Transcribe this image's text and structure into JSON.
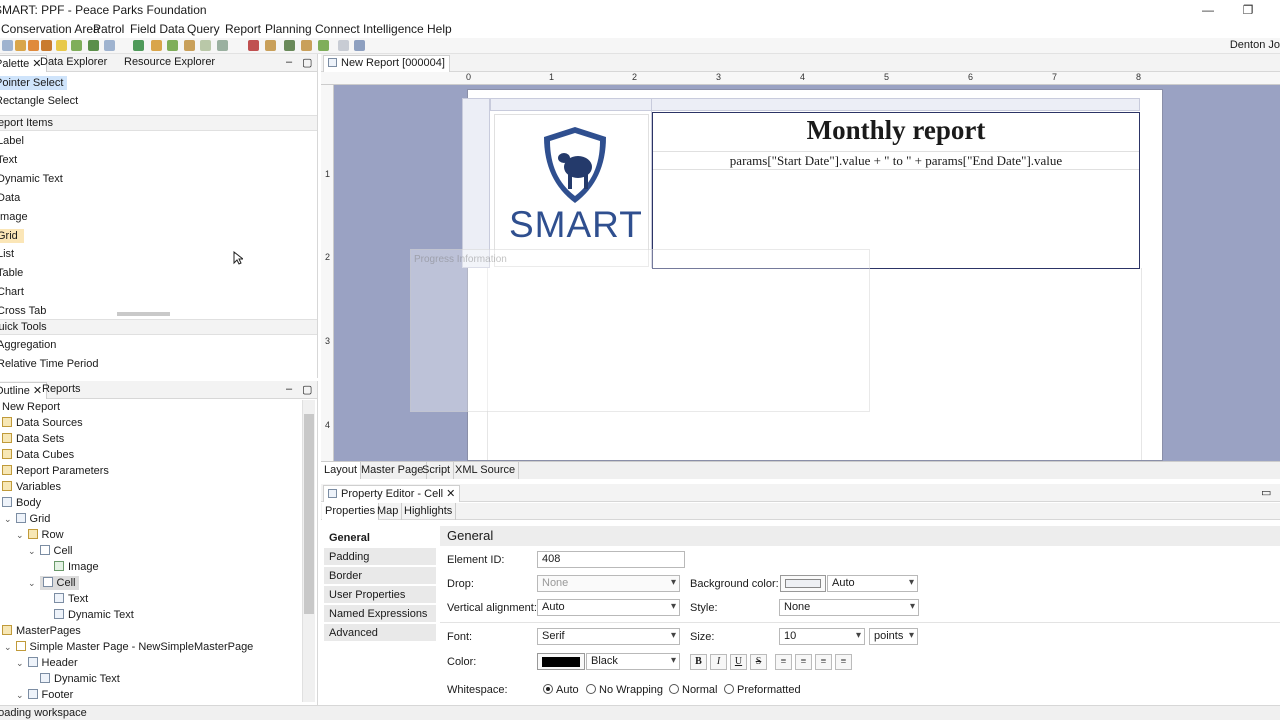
{
  "window": {
    "title": "SMART: PPF - Peace Parks Foundation",
    "min_glyph": "—",
    "restore_glyph": "❐"
  },
  "menu": [
    "Conservation Area",
    "Patrol",
    "Field Data",
    "Query",
    "Report",
    "Planning",
    "Connect",
    "Intelligence",
    "Help"
  ],
  "toolbar": {
    "user": "Denton Jo"
  },
  "palette_tabs": {
    "palette": "Palette",
    "data_explorer": "Data Explorer",
    "resource_explorer": "Resource Explorer"
  },
  "palette": {
    "pointer_select": "Pointer Select",
    "rectangle_select": "Rectangle Select",
    "report_items_header": "Report Items",
    "report_items": [
      "Label",
      "Text",
      "Dynamic Text",
      "Data",
      "Image",
      "Grid",
      "List",
      "Table",
      "Chart",
      "Cross Tab"
    ],
    "quick_tools_header": "Quick Tools",
    "quick_tools": [
      "Aggregation",
      "Relative Time Period"
    ]
  },
  "outline_tabs": {
    "outline": "Outline",
    "reports": "Reports"
  },
  "outline": [
    {
      "label": "New Report",
      "twisty": "",
      "icon": "report"
    },
    {
      "label": "Data Sources",
      "twisty": "",
      "icon": "folder"
    },
    {
      "label": "Data Sets",
      "twisty": "",
      "icon": "folder"
    },
    {
      "label": "Data Cubes",
      "twisty": "",
      "icon": "folder"
    },
    {
      "label": "Report Parameters",
      "twisty": "",
      "icon": "folder"
    },
    {
      "label": "Variables",
      "twisty": "",
      "icon": "folder"
    },
    {
      "label": "Body",
      "twisty": "",
      "icon": "body"
    },
    {
      "label": "Grid",
      "twisty": "⌄",
      "icon": "grid"
    },
    {
      "label": "Row",
      "twisty": "⌄",
      "icon": "row"
    },
    {
      "label": "Cell",
      "twisty": "⌄",
      "icon": "cell"
    },
    {
      "label": "Image",
      "twisty": "",
      "icon": "image"
    },
    {
      "label": "Cell",
      "twisty": "⌄",
      "icon": "cell"
    },
    {
      "label": "Text",
      "twisty": "",
      "icon": "text"
    },
    {
      "label": "Dynamic Text",
      "twisty": "",
      "icon": "dynamic-text"
    },
    {
      "label": "MasterPages",
      "twisty": "",
      "icon": "folder"
    },
    {
      "label": "Simple Master Page - NewSimpleMasterPage",
      "twisty": "⌄",
      "icon": "page"
    },
    {
      "label": "Header",
      "twisty": "⌄",
      "icon": "header"
    },
    {
      "label": "Dynamic Text",
      "twisty": "",
      "icon": "dynamic-text"
    },
    {
      "label": "Footer",
      "twisty": "⌄",
      "icon": "footer"
    }
  ],
  "editor": {
    "tab": "New Report [000004]",
    "ruler_h": [
      "0",
      "1",
      "2",
      "3",
      "4",
      "5",
      "6",
      "7",
      "8"
    ],
    "ruler_v": [
      "1",
      "2",
      "3",
      "4"
    ],
    "logo_text": "SMART",
    "report_title": "Monthly report",
    "report_subtitle": "params[\"Start Date\"].value + \" to \" + params[\"End Date\"].value",
    "progress_dialog": "Progress Information",
    "bottom_tabs": [
      "Layout",
      "Master Page",
      "Script",
      "XML Source"
    ]
  },
  "property_editor": {
    "title": "Property Editor - Cell",
    "tabs": [
      "Properties",
      "Map",
      "Highlights"
    ],
    "categories": [
      "General",
      "Padding",
      "Border",
      "User Properties",
      "Named Expressions",
      "Advanced"
    ],
    "section": "General",
    "element_id_label": "Element ID:",
    "element_id": "408",
    "drop_label": "Drop:",
    "drop_value": "None",
    "bg_color_label": "Background color:",
    "bg_color_value": "Auto",
    "valign_label": "Vertical alignment:",
    "valign_value": "Auto",
    "style_label": "Style:",
    "style_value": "None",
    "font_label": "Font:",
    "font_value": "Serif",
    "size_label": "Size:",
    "size_value": "10",
    "size_unit": "points",
    "color_label": "Color:",
    "color_value": "Black",
    "whitespace_label": "Whitespace:",
    "whitespace_options": [
      "Auto",
      "No Wrapping",
      "Normal",
      "Preformatted"
    ],
    "fmt_buttons": [
      "B",
      "I",
      "U",
      "S"
    ]
  },
  "status": {
    "text": "Loading workspace"
  },
  "colors": {
    "canvas": "#9aa2c3",
    "selection": "#cfe4fb",
    "highlight": "#fbe6b7",
    "logo_blue": "#2f4f8f"
  }
}
